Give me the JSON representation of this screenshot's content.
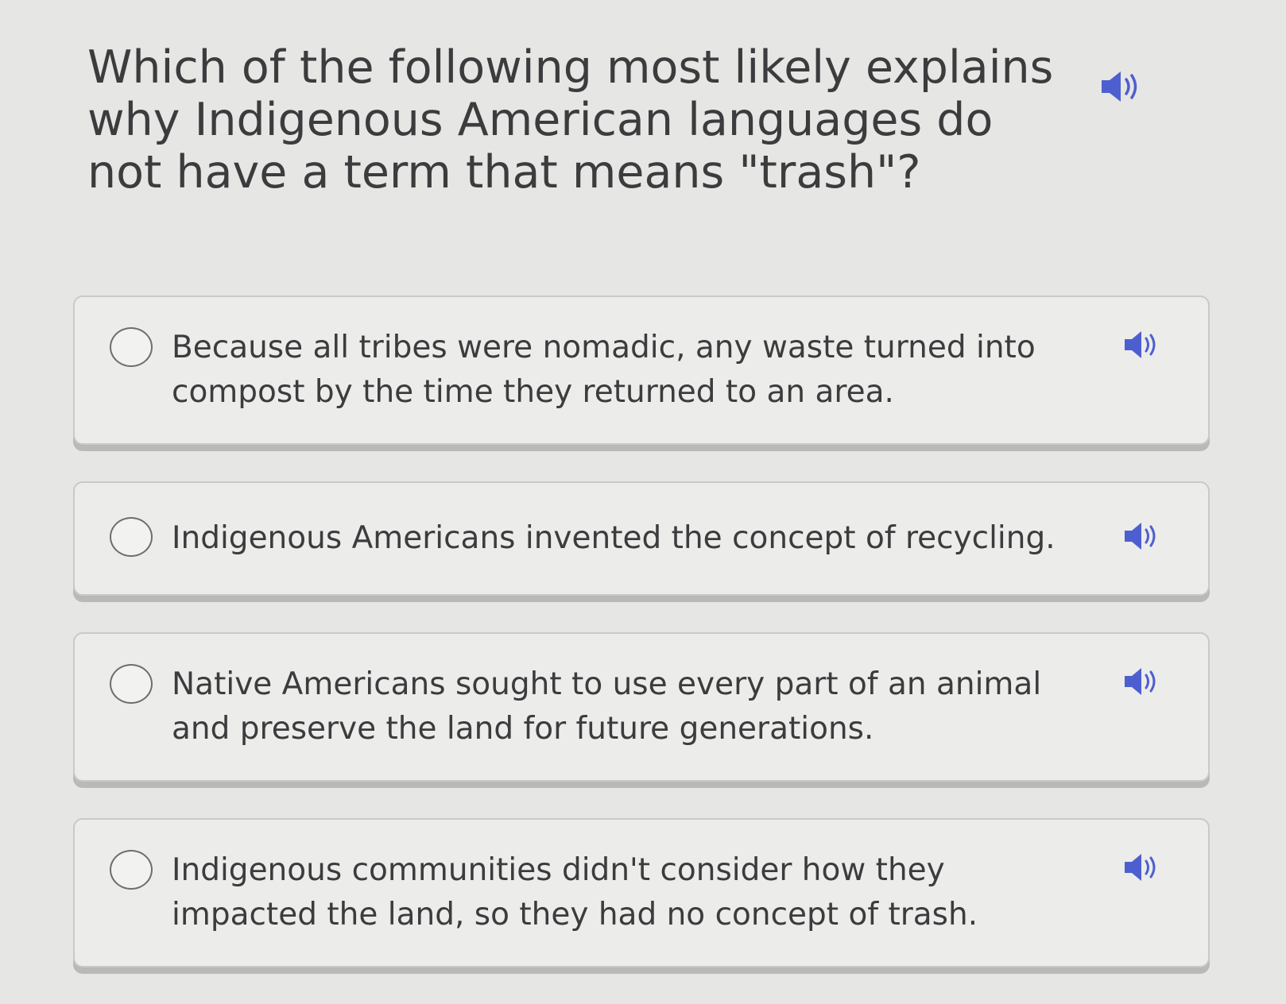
{
  "question": {
    "text": "Which of the following most likely explains why Indigenous American languages do not have a term that means \"trash\"?"
  },
  "options": [
    {
      "text": "Because all tribes were nomadic, any waste turned into compost by the time they returned to an area."
    },
    {
      "text": "Indigenous Americans invented the concept of recycling."
    },
    {
      "text": "Native Americans sought to use every part of an animal and preserve the land for future generations."
    },
    {
      "text": "Indigenous communities didn't consider how they impacted the land, so they had no concept of trash."
    }
  ],
  "colors": {
    "audio_icon": "#4d5fd0",
    "background": "#e6e6e4",
    "text": "#3c3c3e"
  },
  "icons": {
    "audio": "speaker-icon",
    "radio": "radio-circle"
  }
}
